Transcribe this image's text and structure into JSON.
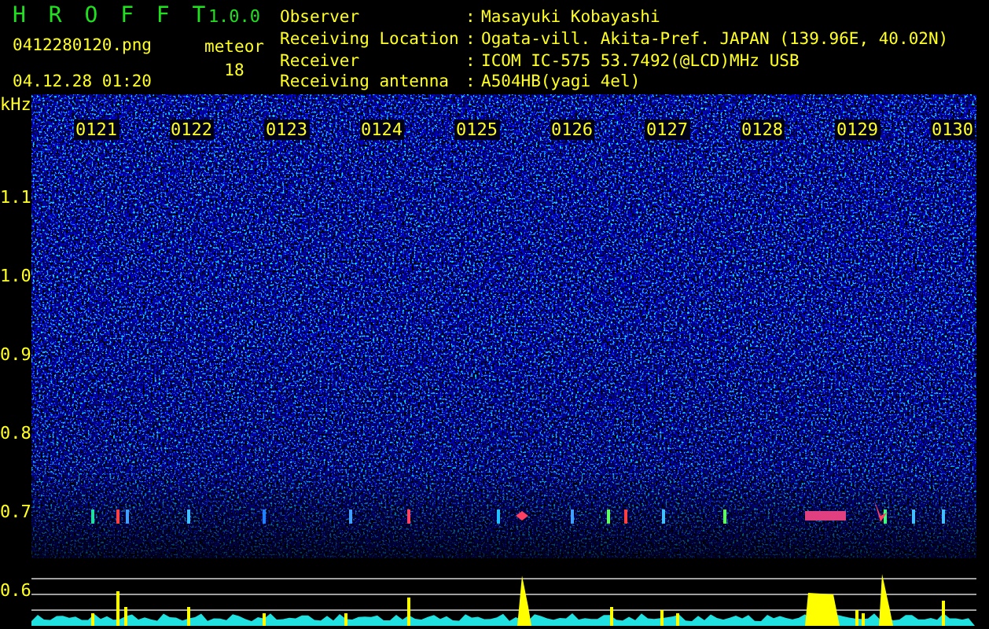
{
  "header": {
    "title": "H R O F F T",
    "version": "1.0.0",
    "file": "0412280120.png",
    "datetime": "04.12.28 01:20",
    "count_label": "meteor",
    "count": "18"
  },
  "info": [
    {
      "label": "Observer",
      "separator": ":",
      "value": "Masayuki Kobayashi"
    },
    {
      "label": "Receiving Location",
      "separator": ":",
      "value": "Ogata-vill. Akita-Pref. JAPAN (139.96E, 40.02N)"
    },
    {
      "label": "Receiver",
      "separator": ":",
      "value": "ICOM IC-575 53.7492(@LCD)MHz USB"
    },
    {
      "label": "Receiving antenna",
      "separator": ":",
      "value": "A504HB(yagi 4el)"
    }
  ],
  "axis": {
    "unit": "kHz",
    "y_labels": [
      "1.1",
      "1.0",
      "0.9",
      "0.8",
      "0.7",
      "0.6"
    ],
    "time_labels": [
      "0121",
      "0122",
      "0123",
      "0124",
      "0125",
      "0126",
      "0127",
      "0128",
      "0129",
      "0130"
    ]
  }
}
